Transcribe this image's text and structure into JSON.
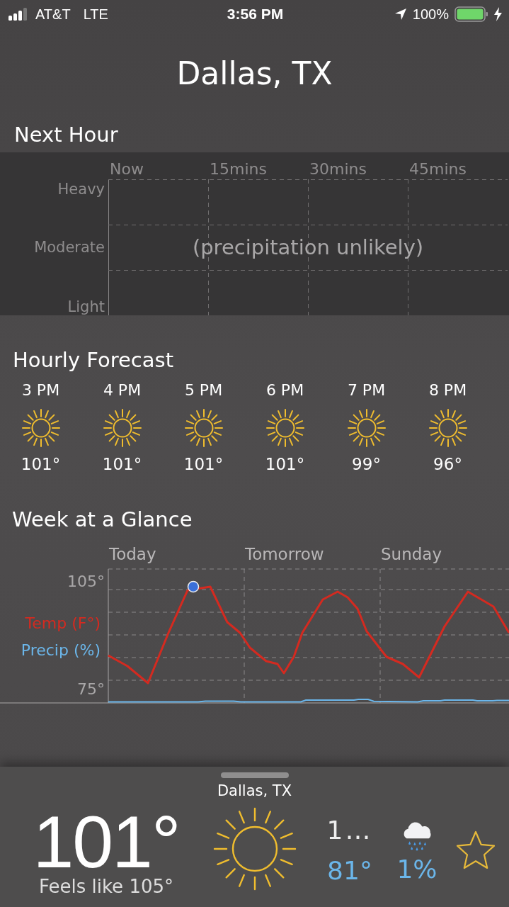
{
  "status_bar": {
    "carrier": "AT&T",
    "network": "LTE",
    "time": "3:56 PM",
    "battery": "100%"
  },
  "location": "Dallas, TX",
  "next_hour": {
    "title": "Next Hour",
    "columns": [
      "Now",
      "15mins",
      "30mins",
      "45mins"
    ],
    "rows": [
      "Heavy",
      "Moderate",
      "Light"
    ],
    "message": "(precipitation unlikely)"
  },
  "hourly": {
    "title": "Hourly Forecast",
    "items": [
      {
        "time": "3 PM",
        "kind": "sunny",
        "temp": "101°"
      },
      {
        "time": "4 PM",
        "kind": "sunny",
        "temp": "101°"
      },
      {
        "time": "5 PM",
        "kind": "sunny",
        "temp": "101°"
      },
      {
        "time": "6 PM",
        "kind": "sunny",
        "temp": "101°"
      },
      {
        "time": "7 PM",
        "kind": "sunny",
        "temp": "99°"
      },
      {
        "time": "8 PM",
        "kind": "sunny",
        "temp": "96°"
      }
    ]
  },
  "week": {
    "title": "Week at a Glance",
    "day_labels": [
      "Today",
      "Tomorrow",
      "Sunday"
    ],
    "temp_labels": [
      "105°",
      "75°"
    ],
    "legend": [
      {
        "kind": "temperature",
        "label": "Temp (F°)",
        "color": "#d42a20"
      },
      {
        "kind": "precipitation",
        "label": "Precip (%)",
        "color": "#6bb6ea"
      }
    ]
  },
  "current": {
    "location": "Dallas, TX",
    "temp": "101°",
    "feels_like": "Feels like 105°",
    "kind": "sunny",
    "high": "1…",
    "low": "81°",
    "precip": {
      "kind": "rain",
      "text": "1%"
    },
    "favorite": false
  }
}
